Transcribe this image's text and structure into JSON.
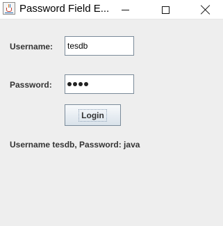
{
  "window": {
    "title": "Password Field E...",
    "app_icon": "java-cup-icon",
    "controls": [
      "minimize-icon",
      "maximize-icon",
      "close-icon"
    ]
  },
  "form": {
    "username_label": "Username:",
    "username_value": "tesdb",
    "password_label": "Password:",
    "password_masked_length": 4,
    "login_label": "Login",
    "status_text": "Username tesdb, Password: java"
  },
  "colors": {
    "window_bg": "#eeeeee",
    "label_text": "#333333",
    "field_border": "#7a8a99"
  }
}
